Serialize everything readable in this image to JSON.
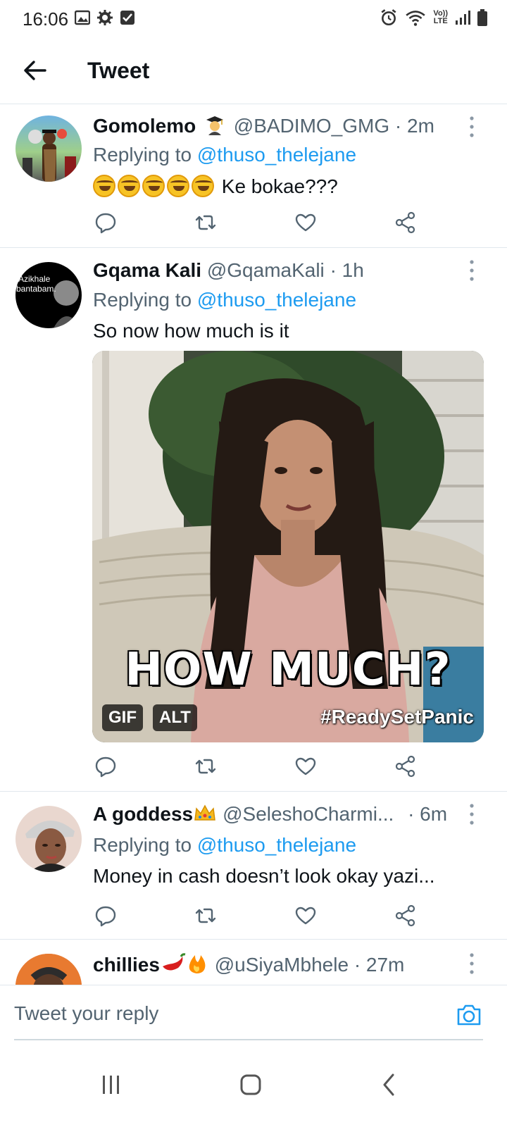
{
  "status_bar": {
    "time": "16:06",
    "network": "LTE",
    "volte": "Vo))"
  },
  "header": {
    "title": "Tweet"
  },
  "colors": {
    "accent": "#1d9bf0",
    "secondary_text": "#536471",
    "divider": "#e1e8ed"
  },
  "tweets": [
    {
      "name": "Gomolemo",
      "name_emoji": "graduate-emoji",
      "handle": "@BADIMO_GMG",
      "time": "· 2m",
      "replying_prefix": "Replying to",
      "replying_to": "@thuso_thelejane",
      "text": "Ke bokae???",
      "text_emojis": 5
    },
    {
      "name": "Gqama Kali",
      "handle": "@GqamaKali",
      "time": "· 1h",
      "replying_prefix": "Replying to",
      "replying_to": "@thuso_thelejane",
      "text": "So now how much is it",
      "avatar_text": "Azikhale bantabam.",
      "media": {
        "caption": "HOW MUCH?",
        "hashtag": "#ReadySetPanic",
        "badge_gif": "GIF",
        "badge_alt": "ALT"
      }
    },
    {
      "name": "A goddess",
      "name_emoji": "crown-emoji",
      "handle": "@SeleshoCharmi...",
      "time": "· 6m",
      "replying_prefix": "Replying to",
      "replying_to": "@thuso_thelejane",
      "text": "Money in cash doesn’t look okay yazi..."
    },
    {
      "name": "chillies",
      "name_emoji": "chili-fire-emoji",
      "handle": "@uSiyaMbhele",
      "time": "· 27m"
    }
  ],
  "reply_bar": {
    "placeholder": "Tweet your reply",
    "icon": "camera-icon"
  },
  "nav_bar": {
    "icons": [
      "recent-apps-icon",
      "home-icon",
      "back-icon"
    ]
  }
}
